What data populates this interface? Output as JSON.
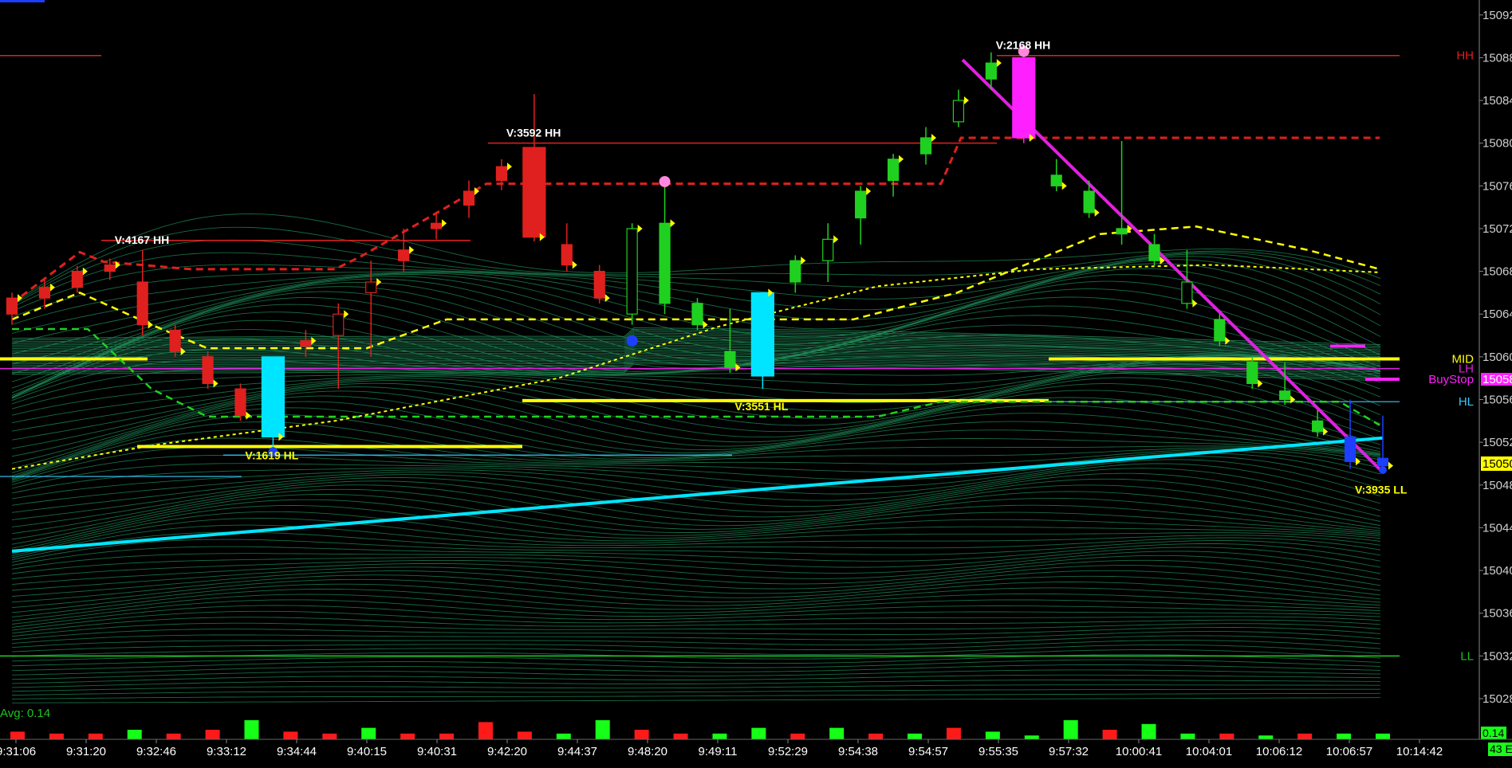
{
  "chart_data": {
    "type": "candlestick",
    "price_axis": {
      "ticks": [
        "15092",
        "15088",
        "15084",
        "15080",
        "15076",
        "15072",
        "15068",
        "15064",
        "15060",
        "15056",
        "15052",
        "15048",
        "15044",
        "15040",
        "15036",
        "15032",
        "15028"
      ],
      "range": [
        15027.4,
        15093.4
      ]
    },
    "time_axis": {
      "labels": [
        "9:31:06",
        "9:31:20",
        "9:32:46",
        "9:33:12",
        "9:34:44",
        "9:40:15",
        "9:40:31",
        "9:42:20",
        "9:44:37",
        "9:48:20",
        "9:49:11",
        "9:52:29",
        "9:54:38",
        "9:54:57",
        "9:55:35",
        "9:57:32",
        "10:00:41",
        "10:04:01",
        "10:06:12",
        "10:06:57",
        "10:14:42"
      ]
    },
    "candles": [
      {
        "o": 15064,
        "h": 15066,
        "l": 15063,
        "c": 15065.5,
        "col": "red"
      },
      {
        "o": 15065.5,
        "h": 15067.2,
        "l": 15064.5,
        "c": 15066.5,
        "col": "red"
      },
      {
        "o": 15066.5,
        "h": 15068.5,
        "l": 15066,
        "c": 15068,
        "col": "red"
      },
      {
        "o": 15068,
        "h": 15069.2,
        "l": 15067.2,
        "c": 15068.6,
        "col": "red"
      },
      {
        "o": 15067,
        "h": 15070,
        "l": 15062,
        "c": 15063,
        "col": "red"
      },
      {
        "o": 15062.5,
        "h": 15063,
        "l": 15060,
        "c": 15060.5,
        "col": "red"
      },
      {
        "o": 15060,
        "h": 15060.5,
        "l": 15057,
        "c": 15057.5,
        "col": "red"
      },
      {
        "o": 15057,
        "h": 15057.5,
        "l": 15054,
        "c": 15054.5,
        "col": "red"
      },
      {
        "o": 15060,
        "h": 15060,
        "l": 15051.5,
        "c": 15052.5,
        "col": "cyan",
        "wide": true
      },
      {
        "o": 15061,
        "h": 15062.5,
        "l": 15060,
        "c": 15061.5,
        "col": "red"
      },
      {
        "o": 15062,
        "h": 15065,
        "l": 15057,
        "c": 15064,
        "col": "red",
        "hollow": true
      },
      {
        "o": 15066,
        "h": 15069,
        "l": 15060,
        "c": 15067,
        "col": "red",
        "hollow": true
      },
      {
        "o": 15069,
        "h": 15072,
        "l": 15068,
        "c": 15070,
        "col": "red"
      },
      {
        "o": 15072,
        "h": 15073.5,
        "l": 15071,
        "c": 15072.5,
        "col": "red"
      },
      {
        "o": 15074.2,
        "h": 15076.5,
        "l": 15073,
        "c": 15075.5,
        "col": "red"
      },
      {
        "o": 15076.5,
        "h": 15078.5,
        "l": 15075.6,
        "c": 15077.8,
        "col": "red"
      },
      {
        "o": 15079.6,
        "h": 15084.6,
        "l": 15070.8,
        "c": 15071.2,
        "col": "red",
        "wide": true
      },
      {
        "o": 15070.5,
        "h": 15072.5,
        "l": 15068,
        "c": 15068.6,
        "col": "red"
      },
      {
        "o": 15068,
        "h": 15068.6,
        "l": 15065,
        "c": 15065.5,
        "col": "red"
      },
      {
        "o": 15064,
        "h": 15072.5,
        "l": 15063,
        "c": 15072,
        "col": "green",
        "hollow": true
      },
      {
        "o": 15065,
        "h": 15076,
        "l": 15064,
        "c": 15072.5,
        "col": "green"
      },
      {
        "o": 15065,
        "h": 15065.5,
        "l": 15062.5,
        "c": 15063,
        "col": "green"
      },
      {
        "o": 15060.5,
        "h": 15064.5,
        "l": 15058.5,
        "c": 15059,
        "col": "green"
      },
      {
        "o": 15058.2,
        "h": 15066,
        "l": 15057,
        "c": 15066,
        "col": "cyan",
        "wide": true
      },
      {
        "o": 15067,
        "h": 15069.5,
        "l": 15066,
        "c": 15069,
        "col": "green"
      },
      {
        "o": 15069,
        "h": 15072.5,
        "l": 15067,
        "c": 15071,
        "col": "green",
        "hollow": true
      },
      {
        "o": 15073,
        "h": 15076,
        "l": 15070.5,
        "c": 15075.5,
        "col": "green"
      },
      {
        "o": 15076.5,
        "h": 15079,
        "l": 15075,
        "c": 15078.5,
        "col": "green"
      },
      {
        "o": 15079,
        "h": 15081.5,
        "l": 15078,
        "c": 15080.5,
        "col": "green"
      },
      {
        "o": 15082,
        "h": 15085,
        "l": 15081.5,
        "c": 15084,
        "col": "green",
        "hollow": true
      },
      {
        "o": 15086,
        "h": 15088.5,
        "l": 15085,
        "c": 15087.5,
        "col": "green"
      },
      {
        "o": 15088,
        "h": 15088.8,
        "l": 15080,
        "c": 15080.5,
        "col": "magenta",
        "wide": true
      },
      {
        "o": 15077,
        "h": 15078.5,
        "l": 15075.5,
        "c": 15076,
        "col": "green"
      },
      {
        "o": 15075.5,
        "h": 15076.5,
        "l": 15073,
        "c": 15073.5,
        "col": "green"
      },
      {
        "o": 15071.5,
        "h": 15080.2,
        "l": 15070.5,
        "c": 15072,
        "col": "green"
      },
      {
        "o": 15070.5,
        "h": 15071.5,
        "l": 15068.5,
        "c": 15069,
        "col": "green"
      },
      {
        "o": 15067,
        "h": 15070,
        "l": 15064.5,
        "c": 15065,
        "col": "green",
        "hollow": true
      },
      {
        "o": 15063.5,
        "h": 15064,
        "l": 15061,
        "c": 15061.5,
        "col": "green"
      },
      {
        "o": 15059.5,
        "h": 15060,
        "l": 15057,
        "c": 15057.5,
        "col": "green"
      },
      {
        "o": 15056.8,
        "h": 15059.5,
        "l": 15055.5,
        "c": 15056,
        "col": "green"
      },
      {
        "o": 15054,
        "h": 15055,
        "l": 15052.5,
        "c": 15053,
        "col": "green"
      },
      {
        "o": 15052.5,
        "h": 15056,
        "l": 15049.5,
        "c": 15050.2,
        "col": "blue"
      },
      {
        "o": 15050.5,
        "h": 15054.5,
        "l": 15049.5,
        "c": 15049.8,
        "col": "blue"
      }
    ],
    "annotations": [
      {
        "text": "V:4167 HH",
        "price": 15070.0,
        "candle": 4,
        "pos": "above"
      },
      {
        "text": "V:1619 HL",
        "price": 15052.2,
        "candle": 8,
        "pos": "below"
      },
      {
        "text": "V:3592 HH",
        "price": 15080.0,
        "candle": 16,
        "pos": "above"
      },
      {
        "text": "V:3551 HL",
        "price": 15056.8,
        "candle": 23,
        "pos": "below"
      },
      {
        "text": "V:2168 HH",
        "price": 15088.2,
        "candle": 31,
        "pos": "above"
      },
      {
        "text": "V:3935 LL",
        "price": 15049.0,
        "candle": 42,
        "pos": "below"
      }
    ],
    "levels": [
      {
        "label": "HH",
        "price": 15088.2,
        "color": "#e0201e"
      },
      {
        "label": "MID",
        "price": 15059.8,
        "color": "#ffff00"
      },
      {
        "label": "LH",
        "price": 15058.9,
        "color": "#e020e0"
      },
      {
        "label": "BuyStop",
        "price": 15057.9,
        "color": "#ff20ff",
        "badge": "15058"
      },
      {
        "label": "HL",
        "price": 15055.8,
        "color": "#33ccff"
      },
      {
        "label": "LL",
        "price": 15032.0,
        "color": "#20c020"
      }
    ],
    "current_price_badge": "15050",
    "volume": {
      "label": "Avg: 0.14",
      "badge": "0.14",
      "bars": [
        {
          "v": 0.4,
          "c": "red"
        },
        {
          "v": 0.3,
          "c": "red"
        },
        {
          "v": 0.3,
          "c": "red"
        },
        {
          "v": 0.5,
          "c": "green"
        },
        {
          "v": 0.3,
          "c": "red"
        },
        {
          "v": 0.5,
          "c": "red"
        },
        {
          "v": 1.0,
          "c": "green"
        },
        {
          "v": 0.4,
          "c": "red"
        },
        {
          "v": 0.3,
          "c": "red"
        },
        {
          "v": 0.6,
          "c": "green"
        },
        {
          "v": 0.3,
          "c": "red"
        },
        {
          "v": 0.3,
          "c": "red"
        },
        {
          "v": 0.9,
          "c": "red"
        },
        {
          "v": 0.4,
          "c": "red"
        },
        {
          "v": 0.3,
          "c": "green"
        },
        {
          "v": 1.0,
          "c": "green"
        },
        {
          "v": 0.5,
          "c": "red"
        },
        {
          "v": 0.3,
          "c": "red"
        },
        {
          "v": 0.3,
          "c": "green"
        },
        {
          "v": 0.6,
          "c": "green"
        },
        {
          "v": 0.3,
          "c": "red"
        },
        {
          "v": 0.6,
          "c": "green"
        },
        {
          "v": 0.3,
          "c": "red"
        },
        {
          "v": 0.3,
          "c": "green"
        },
        {
          "v": 0.6,
          "c": "red"
        },
        {
          "v": 0.4,
          "c": "green"
        },
        {
          "v": 0.2,
          "c": "green"
        },
        {
          "v": 1.0,
          "c": "green"
        },
        {
          "v": 0.5,
          "c": "red"
        },
        {
          "v": 0.8,
          "c": "green"
        },
        {
          "v": 0.3,
          "c": "green"
        },
        {
          "v": 0.3,
          "c": "red"
        },
        {
          "v": 0.2,
          "c": "green"
        },
        {
          "v": 0.3,
          "c": "red"
        },
        {
          "v": 0.3,
          "c": "green"
        },
        {
          "v": 0.3,
          "c": "green"
        }
      ]
    },
    "partial_badge": "43 E",
    "colors": {
      "ribbon": "#1f8f5a",
      "yellow": "#ffff00",
      "red": "#e0201e",
      "green": "#20d020",
      "cyan": "#00e5ff",
      "magenta": "#ff20ff",
      "trend_up": "#00e5ff",
      "trend_down": "#e020e0"
    }
  }
}
